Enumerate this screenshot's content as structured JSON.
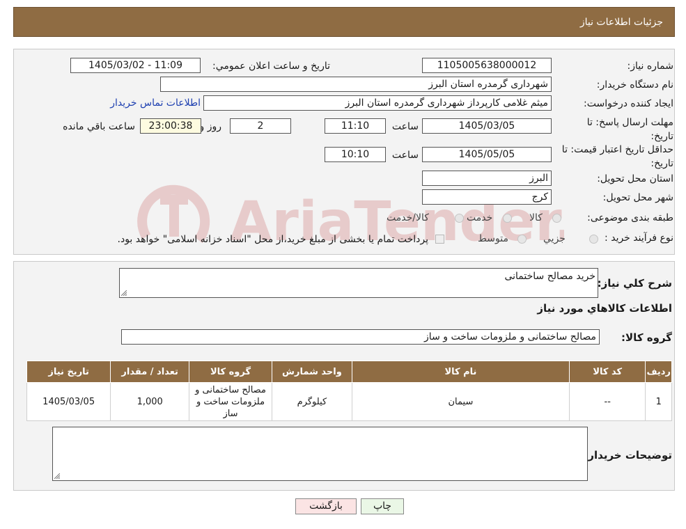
{
  "header": {
    "title": "جزئیات اطلاعات نیاز"
  },
  "form": {
    "need_number": {
      "label": "شماره نیاز:",
      "value": "1105005638000012"
    },
    "announce_datetime": {
      "label": "تاریخ و ساعت اعلان عمومي:",
      "value": "1405/03/02 - 11:09"
    },
    "buyer_org": {
      "label": "نام دستگاه خريدار:",
      "value": "شهرداری گرمدره استان البرز"
    },
    "requester": {
      "label": "ايجاد کننده درخواست:",
      "value": "میثم غلامی کارپرداز شهرداری گرمدره استان البرز",
      "contact_link": "اطلاعات تماس خريدار"
    },
    "deadline": {
      "label": "مهلت ارسال پاسخ: تا تاریخ:",
      "date": "1405/03/05",
      "time_label": "ساعت",
      "time": "11:10",
      "days": "2",
      "days_label": "روز و",
      "remaining": "23:00:38",
      "remaining_label": "ساعت باقي مانده"
    },
    "price_validity": {
      "label": "حداقل تاریخ اعتبار قیمت: تا تاریخ:",
      "date": "1405/05/05",
      "time_label": "ساعت",
      "time": "10:10"
    },
    "province": {
      "label": "استان محل تحویل:",
      "value": "البرز"
    },
    "city": {
      "label": "شهر محل تحویل:",
      "value": "کرج"
    },
    "category": {
      "label": "طبقه بندی موضوعی:",
      "options": [
        "کالا",
        "خدمت",
        "کالا/خدمت"
      ]
    },
    "process_type": {
      "label": "نوع فرآیند خرید :",
      "options": [
        "جزیي",
        "متوسط"
      ],
      "note": "پرداخت تمام یا بخشی از مبلغ خرید،از محل \"اسناد خزانه اسلامی\" خواهد بود."
    }
  },
  "summary": {
    "general_desc_label": "شرح کلي نياز:",
    "general_desc_value": "خرید مصالح ساختمانی",
    "items_title": "اطلاعات کالاهاي مورد نياز",
    "goods_group_label": "گروه کالا:",
    "goods_group_value": "مصالح ساختمانی و ملزومات ساخت و ساز",
    "table": {
      "headers": [
        "رديف",
        "کد کالا",
        "نام کالا",
        "واحد شمارش",
        "گروه کالا",
        "تعداد / مقدار",
        "تاريخ نياز"
      ],
      "rows": [
        {
          "row": "1",
          "code": "--",
          "name": "سیمان",
          "unit": "کیلوگرم",
          "group": "مصالح ساختمانی و ملزومات ساخت و ساز",
          "qty": "1,000",
          "date": "1405/03/05"
        }
      ]
    },
    "buyer_notes_label": "توضیحات خریدار:",
    "buyer_notes_value": ""
  },
  "buttons": {
    "print": "چاپ",
    "back": "بازگشت"
  },
  "colors": {
    "header_bg": "#8f6c43",
    "back_bg": "#fbe4e4",
    "print_bg": "#eaf7e6"
  },
  "watermark": {
    "text": "AriaTender.neT"
  }
}
